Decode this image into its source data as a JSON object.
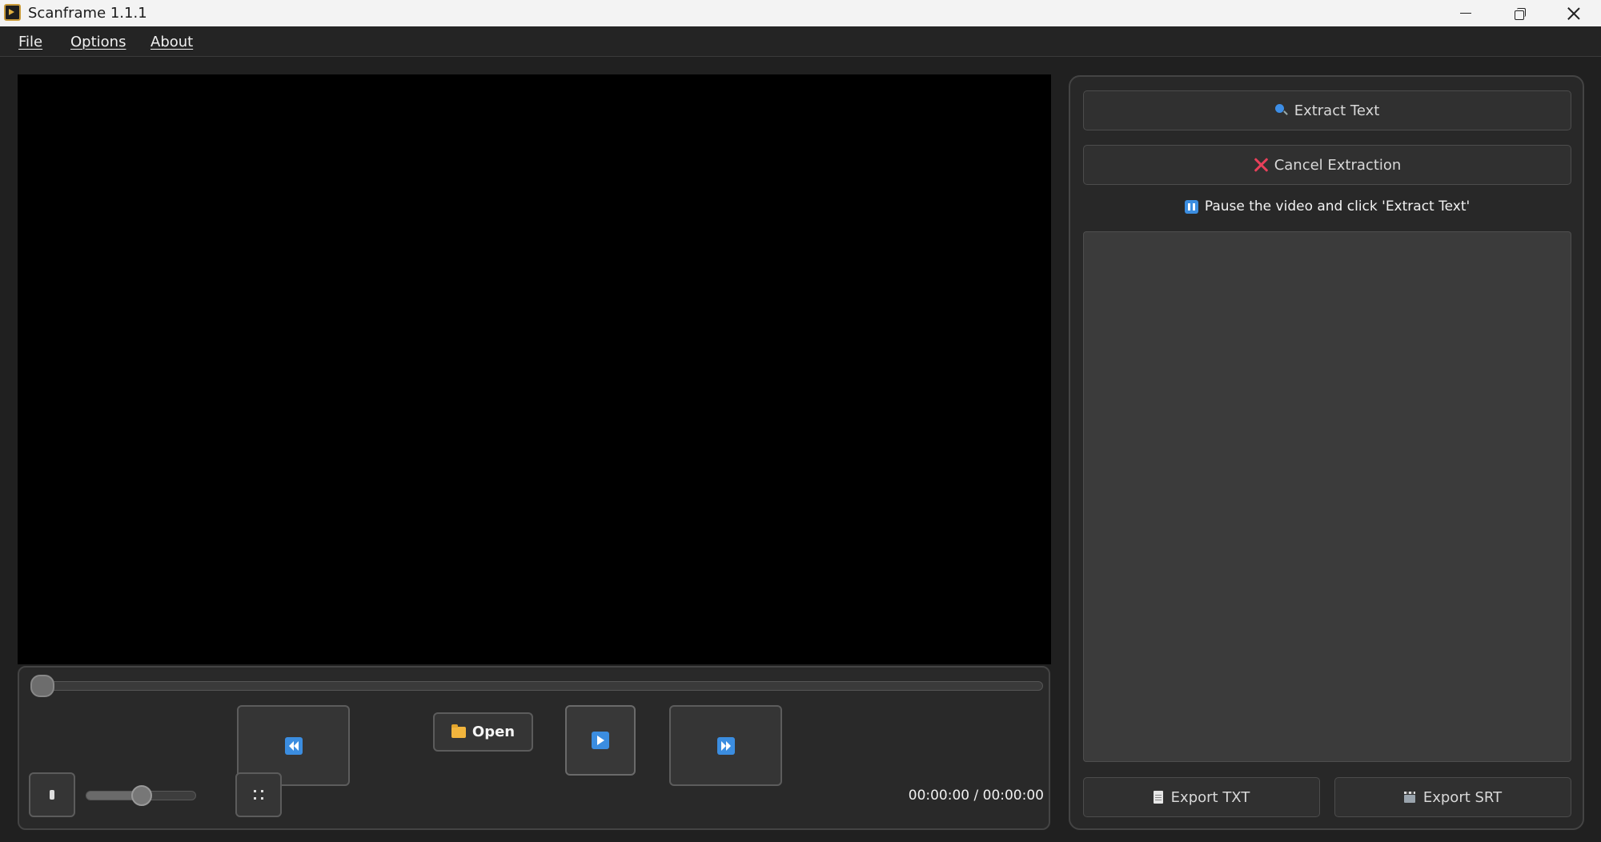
{
  "window": {
    "title": "Scanframe 1.1.1",
    "icon": "scanframe-app-icon"
  },
  "menu": {
    "file": "File",
    "options": "Options",
    "about": "About"
  },
  "player": {
    "seek_position": 0,
    "volume_level": 0.5,
    "time_display": "00:00:00 / 00:00:00",
    "open_label": "Open",
    "icons": {
      "mute": "volume-icon",
      "rewind": "rewind-icon",
      "open": "folder-icon",
      "play": "play-icon",
      "fast_forward": "fast-forward-icon",
      "fullscreen": "fullscreen-icon"
    }
  },
  "sidebar": {
    "extract_label": "Extract Text",
    "cancel_label": "Cancel Extraction",
    "hint": "Pause the video and click 'Extract Text'",
    "output_text": "",
    "export_txt_label": "Export TXT",
    "export_srt_label": "Export SRT"
  },
  "colors": {
    "accent_blue": "#3b8de0",
    "cancel_red": "#e8405a",
    "folder_yellow": "#f2b53d",
    "background": "#202020"
  }
}
